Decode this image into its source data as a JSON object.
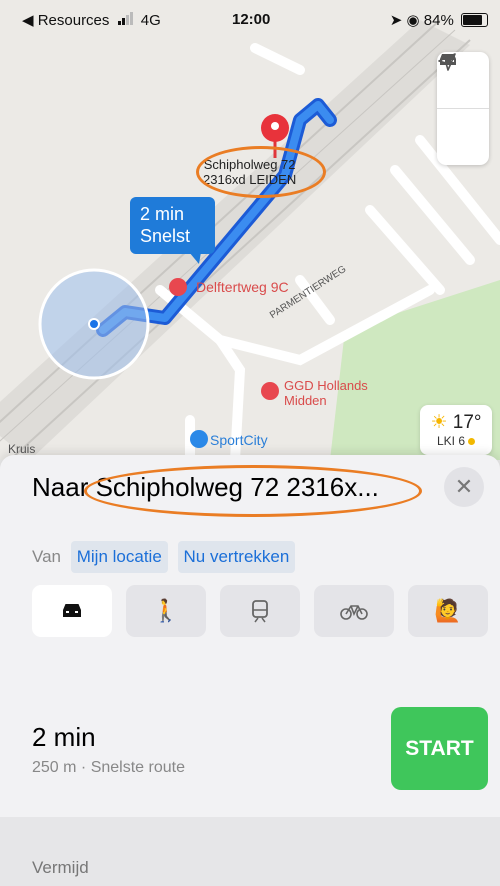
{
  "status_bar": {
    "back_app": "◀ Resources",
    "network": "4G",
    "time": "12:00",
    "battery": "84%"
  },
  "map": {
    "destination_line1": "Schipholweg 72",
    "destination_line2": "2316xd LEIDEN",
    "route_time": "2 min",
    "route_type": "Snelst",
    "poi_1": "Delftertweg 9C",
    "poi_2_line1": "GGD Hollands",
    "poi_2_line2": "Midden",
    "poi_3": "SportCity",
    "street": "PARMENTIERWEG",
    "street_2": "Kruis",
    "weather_temp": "17°",
    "weather_index": "LKI 6",
    "icons": [
      "car-icon",
      "location-arrow-icon"
    ]
  },
  "sheet": {
    "title": "Naar Schipholweg 72 2316x...",
    "from_label": "Van",
    "from_chip": "Mijn locatie",
    "time_chip": "Nu vertrekken",
    "modes": [
      "car-icon",
      "walk-icon",
      "train-icon",
      "bike-icon",
      "rideshare-icon"
    ],
    "active_mode": "car",
    "eta": "2 min",
    "eta_detail": "250 m · Snelste route",
    "start_label": "START",
    "avoid_label": "Vermijd"
  },
  "colors": {
    "route": "#1a73e8",
    "start": "#3fc65b",
    "annotation": "#ea7d24",
    "park": "#cfe8c0"
  }
}
